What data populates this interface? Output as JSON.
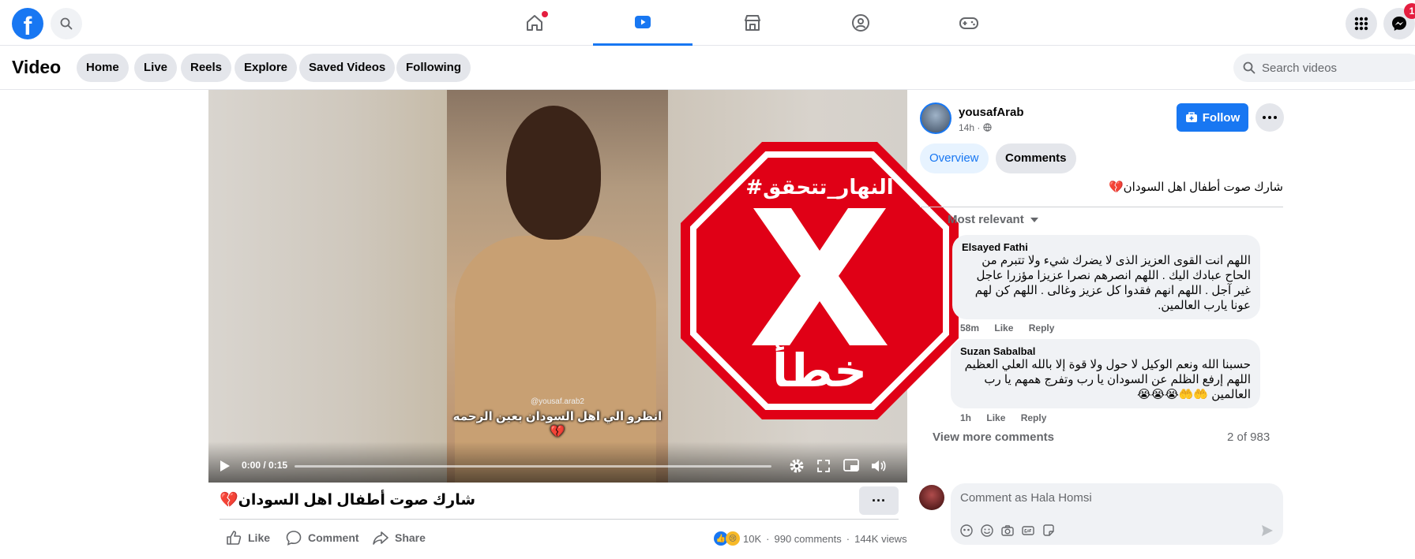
{
  "topbar": {
    "logo": "f",
    "icons": [
      "search-icon",
      "home-icon",
      "video-icon",
      "marketplace-icon",
      "groups-icon",
      "gaming-icon",
      "menu-grid-icon",
      "messenger-icon"
    ],
    "notification_count": "1"
  },
  "subbar": {
    "title": "Video",
    "nav": [
      "Home",
      "Live",
      "Reels",
      "Explore",
      "Saved Videos",
      "Following"
    ],
    "search_placeholder": "Search videos"
  },
  "player": {
    "watermark": "@yousaf.arab2",
    "caption": "انظرو الي اهل السودان بعين الرحمه💔",
    "time": "0:00 / 0:15",
    "progress": 0,
    "stamp": {
      "hashtag": "#النهار_تتحقق",
      "verdict": "خطأ"
    }
  },
  "post": {
    "title": "شارك صوت أطفال اهل السودان💔",
    "more": "···",
    "actions": {
      "like": "Like",
      "comment": "Comment",
      "share": "Share"
    },
    "stats": {
      "reactions": "10K",
      "comments": "990 comments",
      "views": "144K views",
      "separator": "·"
    }
  },
  "sidebar": {
    "author": "yousafArab",
    "time": "14h ·",
    "follow": "Follow",
    "tabs": {
      "overview": "Overview",
      "comments": "Comments"
    },
    "description": "شارك صوت أطفال اهل السودان💔",
    "sort": "Most relevant",
    "comments": [
      {
        "author": "Elsayed Fathi",
        "text": "اللهم انت القوى العزيز الذى لا يضرك شيء ولا تتبرم من الحاح عبادك اليك . اللهم انصرهم نصرا عزيزا مؤزرا عاجل غير آجل . اللهم انهم فقدوا كل عزيز وغالى . اللهم كن لهم عونا يارب العالمين.",
        "time": "58m",
        "like": "Like",
        "reply": "Reply"
      },
      {
        "author": "Suzan Sabalbal",
        "text": "حسبنا الله ونعم الوكيل لا حول ولا قوة إلا بالله العلي العظيم اللهم إرفع الظلم عن السودان يا رب وتفرج همهم يا رب العالمين 🤲🤲😭😭😭",
        "time": "1h",
        "like": "Like",
        "reply": "Reply"
      }
    ],
    "view_more": "View more comments",
    "count": "2 of 983",
    "comment_placeholder": "Comment as Hala Homsi"
  }
}
